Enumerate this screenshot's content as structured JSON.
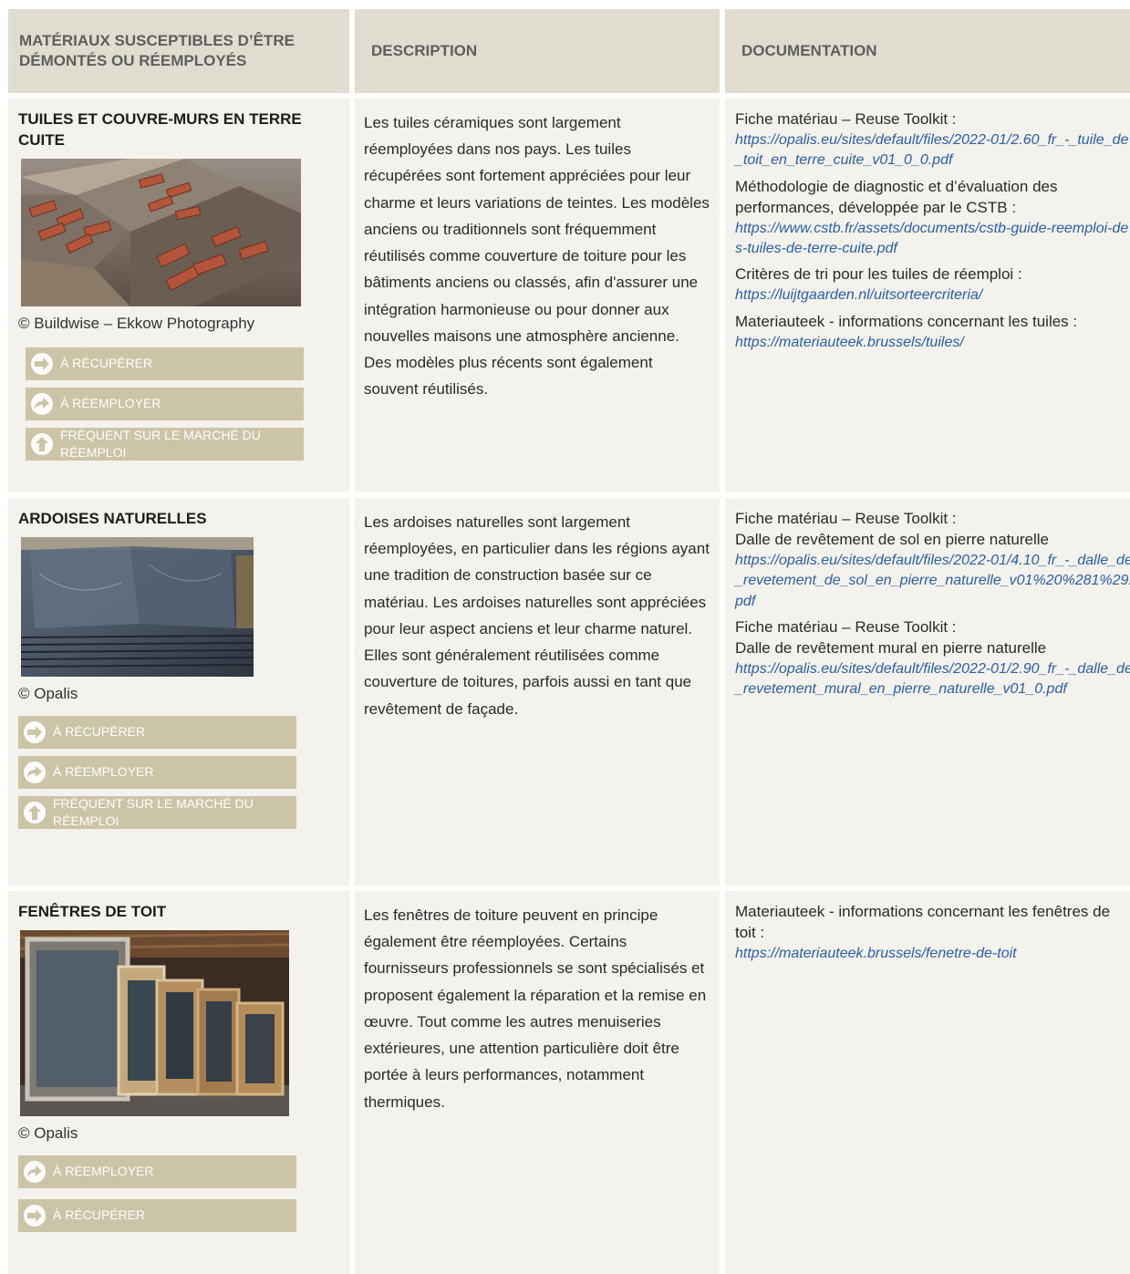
{
  "header": {
    "col1": "Matériaux susceptibles d’être démontés ou réemployés",
    "col2": "Description",
    "col3": "Documentation"
  },
  "colors": {
    "header_bg": "#e0ddd0",
    "cell_bg": "#f3f2ec",
    "tag_bg": "#cbc4a7",
    "link": "#2b5fa6"
  },
  "rows": [
    {
      "title": "Tuiles et couvre-murs en terre cuite",
      "photo_subject": "stacks of reclaimed clay roof tiles in wooden crates",
      "credit": "© Buildwise – Ekkow Photography",
      "tags": [
        {
          "icon": "arrow-right-icon",
          "label": "À récupérer"
        },
        {
          "icon": "arrow-curve-right-icon",
          "label": "À réemployer"
        },
        {
          "icon": "arrow-up-icon",
          "label": "Fréquent sur le marché du réemploi"
        }
      ],
      "description": "Les tuiles céramiques sont largement réemployées dans nos pays. Les tuiles récupérées sont fortement appréciées pour leur charme et leurs variations de teintes. Les modèles anciens ou traditionnels sont fréquemment réutilisés comme couverture de toiture pour les bâtiments anciens ou classés, afin d'assurer une intégration harmonieuse ou pour donner aux nouvelles maisons une atmosphère ancienne. Des modèles plus récents sont également souvent réutilisés.",
      "docs": [
        {
          "label": "Fiche matériau – Reuse Toolkit :",
          "link": "https://opalis.eu/sites/default/files/2022-01/2.60_fr_-_tuile_de_toit_en_terre_cuite_v01_0_0.pdf"
        },
        {
          "label": "Méthodologie de diagnostic et d’évaluation des performances, développée par le CSTB :",
          "link": "https://www.cstb.fr/assets/documents/cstb-guide-reemploi-des-tuiles-de-terre-cuite.pdf"
        },
        {
          "label": "Critères de tri pour les tuiles de réemploi :",
          "link": "https://luijtgaarden.nl/uitsorteercriteria/"
        },
        {
          "label": "Materiauteek - informations concernant les tuiles :",
          "link": "https://materiauteek.brussels/tuiles/"
        }
      ]
    },
    {
      "title": "Ardoises naturelles",
      "photo_subject": "stacked natural slate sheets",
      "credit": "© Opalis",
      "tags": [
        {
          "icon": "arrow-right-icon",
          "label": "À récupérer"
        },
        {
          "icon": "arrow-curve-right-icon",
          "label": "À réemployer"
        },
        {
          "icon": "arrow-up-icon",
          "label": "Fréquent sur le marché du réemploi"
        }
      ],
      "description": "Les ardoises naturelles sont largement réemployées, en particulier dans les régions ayant une tradition de construction basée sur ce matériau. Les ardoises naturelles sont appréciées pour leur aspect anciens et leur charme naturel. Elles sont généralement réutilisées comme couverture de toitures, parfois aussi en tant que revêtement de façade.",
      "docs": [
        {
          "label": "Fiche matériau – Reuse Toolkit :",
          "sublabel": "Dalle de revêtement de sol en pierre naturelle",
          "link": "https://opalis.eu/sites/default/files/2022-01/4.10_fr_-_dalle_de_revetement_de_sol_en_pierre_naturelle_v01%20%281%29.pdf"
        },
        {
          "label": "Fiche matériau – Reuse Toolkit :",
          "sublabel": "Dalle de revêtement mural en pierre naturelle",
          "link": "https://opalis.eu/sites/default/files/2022-01/2.90_fr_-_dalle_de_revetement_mural_en_pierre_naturelle_v01_0.pdf"
        }
      ]
    },
    {
      "title": "Fenêtres de toit",
      "photo_subject": "reclaimed roof windows stacked in a warehouse",
      "credit": "© Opalis",
      "tags": [
        {
          "icon": "arrow-curve-right-icon",
          "label": "À réemployer"
        },
        {
          "icon": "arrow-right-icon",
          "label": "À récupérer"
        }
      ],
      "description": "Les fenêtres de toiture peuvent en principe également être réemployées. Certains fournisseurs professionnels se sont spécialisés et proposent également la réparation et la remise en œuvre. Tout comme les autres menuiseries extérieures, une attention particulière doit être portée à leurs performances, notamment thermiques.",
      "docs": [
        {
          "label": "Materiauteek - informations concernant les fenêtres de toit :",
          "link": "https://materiauteek.brussels/fenetre-de-toit"
        }
      ]
    }
  ]
}
